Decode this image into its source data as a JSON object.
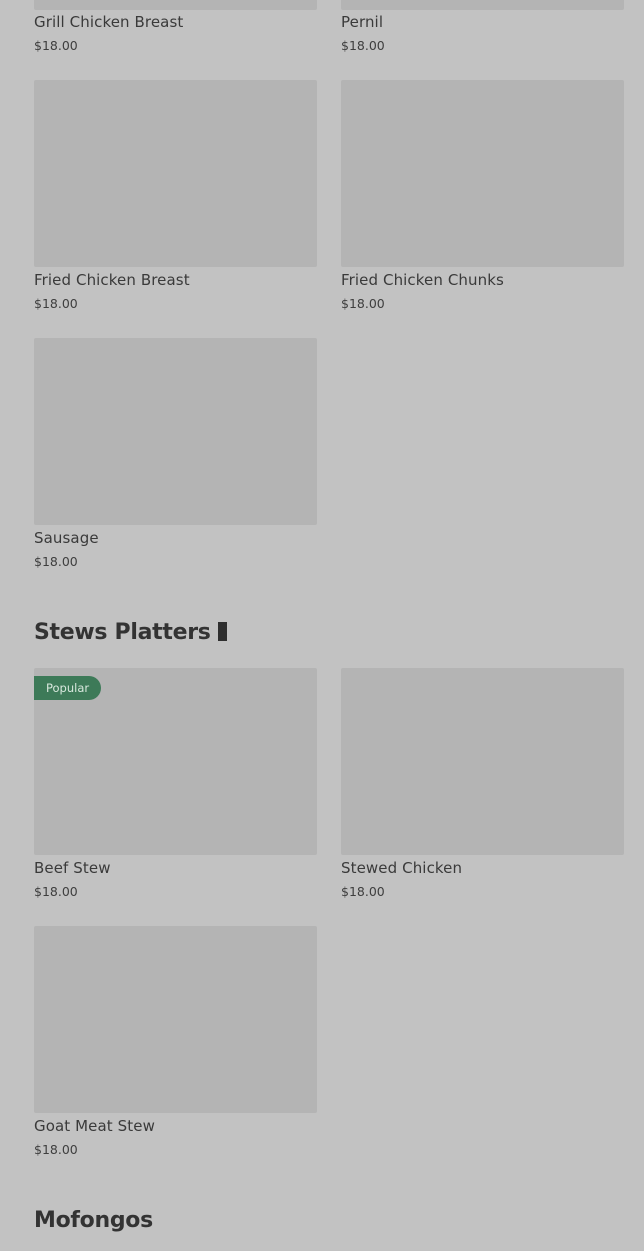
{
  "menu": {
    "items_top": [
      {
        "name": "Grill Chicken Breast",
        "price": "$18.00"
      },
      {
        "name": "Pernil",
        "price": "$18.00"
      },
      {
        "name": "Fried Chicken Breast",
        "price": "$18.00"
      },
      {
        "name": "Fried Chicken Chunks",
        "price": "$18.00"
      },
      {
        "name": "Sausage",
        "price": "$18.00"
      }
    ],
    "stews": {
      "title": "Stews Platters",
      "items": [
        {
          "name": "Beef Stew",
          "price": "$18.00",
          "badge": "Popular"
        },
        {
          "name": "Stewed Chicken",
          "price": "$18.00"
        },
        {
          "name": "Goat Meat Stew",
          "price": "$18.00"
        }
      ]
    },
    "mofongos": {
      "title": "Mofongos"
    }
  },
  "colors": {
    "background": "#c2c2c2",
    "image_placeholder": "#b4b4b4",
    "popular_badge": "#3d7a58"
  }
}
